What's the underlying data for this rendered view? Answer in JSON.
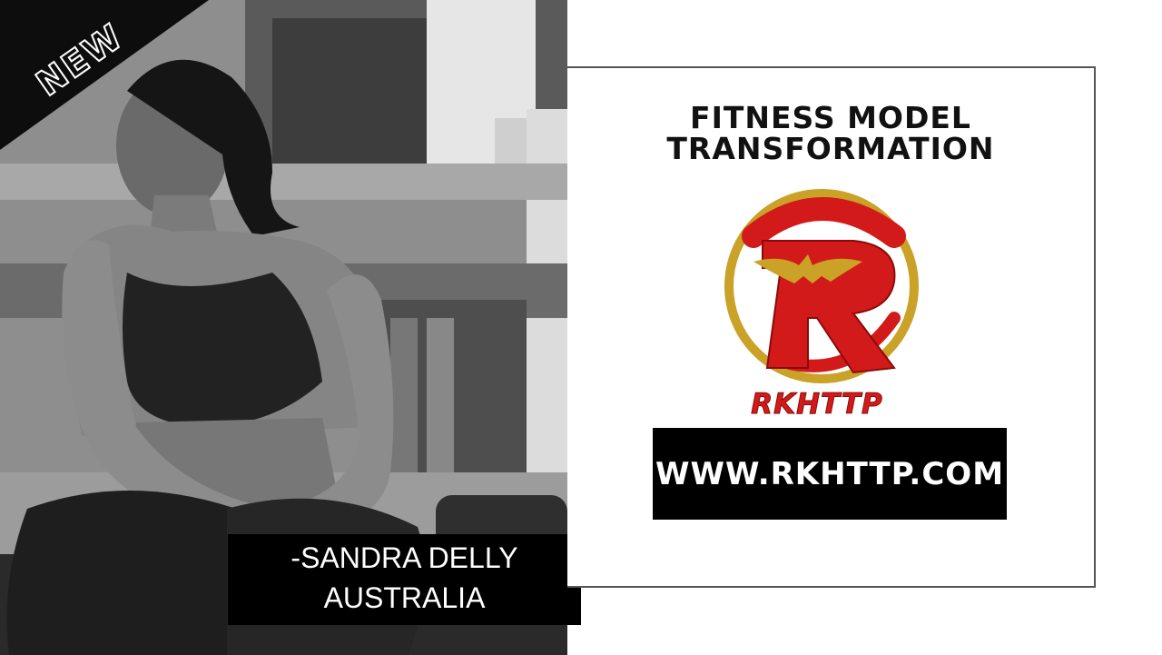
{
  "ribbon": {
    "label": "NEW"
  },
  "caption": {
    "line1": "-SANDRA DELLY",
    "line2": "AUSTRALIA"
  },
  "headline": {
    "line1": "FITNESS MODEL",
    "line2": "TRANSFORMATION"
  },
  "logo": {
    "letter": "R",
    "brand": "RKHTTP"
  },
  "website": {
    "url": "WWW.RKHTTP.COM"
  },
  "colors": {
    "brand_red": "#d21a1a",
    "gold": "#c9a227",
    "black": "#000000",
    "white": "#ffffff"
  },
  "icons": {
    "logo": "rkhttp-logo-icon",
    "gym_photo": "gym-photo-icon"
  }
}
